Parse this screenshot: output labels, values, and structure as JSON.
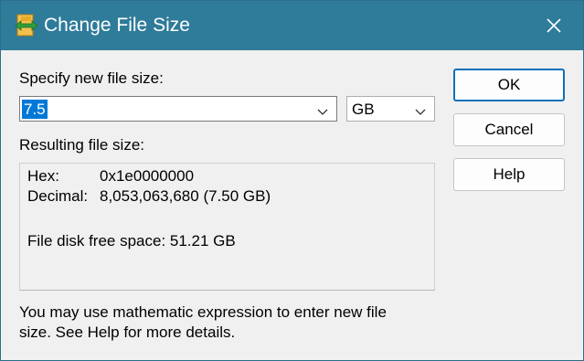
{
  "window": {
    "title": "Change File Size",
    "app_icon": "resize-file-icon",
    "close_icon": "close-icon"
  },
  "new_size": {
    "label": "Specify new file size:",
    "value": "7.5",
    "unit": "GB",
    "dropdown_icon": "chevron-down-icon"
  },
  "result": {
    "label": "Resulting file size:",
    "hex_label": "Hex:",
    "hex_value": "0x1e0000000",
    "decimal_label": "Decimal:",
    "decimal_value": "8,053,063,680 (7.50 GB)",
    "free_space": "File disk free space: 51.21 GB"
  },
  "buttons": {
    "ok": "OK",
    "cancel": "Cancel",
    "help": "Help"
  },
  "hint": {
    "line1": "You may use mathematic expression to enter new file",
    "line2": "size. See Help for more details."
  },
  "colors": {
    "titlebar": "#2f7b9a",
    "selection": "#0078d7",
    "default_button_border": "#0f70b8"
  }
}
